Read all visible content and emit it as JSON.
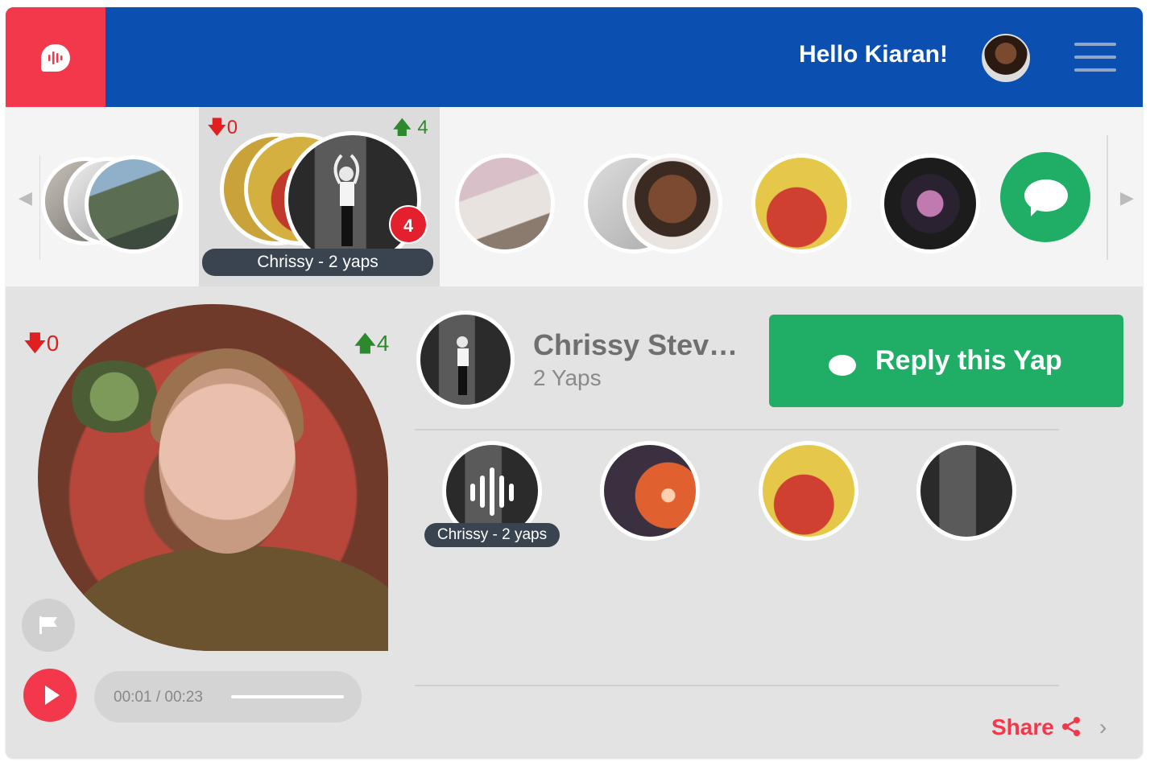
{
  "header": {
    "greeting": "Hello Kiaran!",
    "logo_icon": "mic-bubble-icon",
    "menu_icon": "hamburger-icon",
    "colors": {
      "brand_red": "#f2384a",
      "brand_blue": "#0b4fb0",
      "green": "#20ae66"
    }
  },
  "strip": {
    "selected": {
      "down_votes": "0",
      "up_votes": "4",
      "badge": "4",
      "label": "Chrissy - 2 yaps"
    },
    "new_yap_icon": "chat-bubble-icon"
  },
  "main": {
    "down_votes": "0",
    "up_votes": "4",
    "author_name": "Chrissy Stev…",
    "author_yaps": "2 Yaps",
    "reply_label": "Reply this Yap",
    "player_time": "00:01 / 00:23",
    "progress": 0.04,
    "thumb_label": "Chrissy - 2 yaps",
    "share_label": "Share"
  }
}
